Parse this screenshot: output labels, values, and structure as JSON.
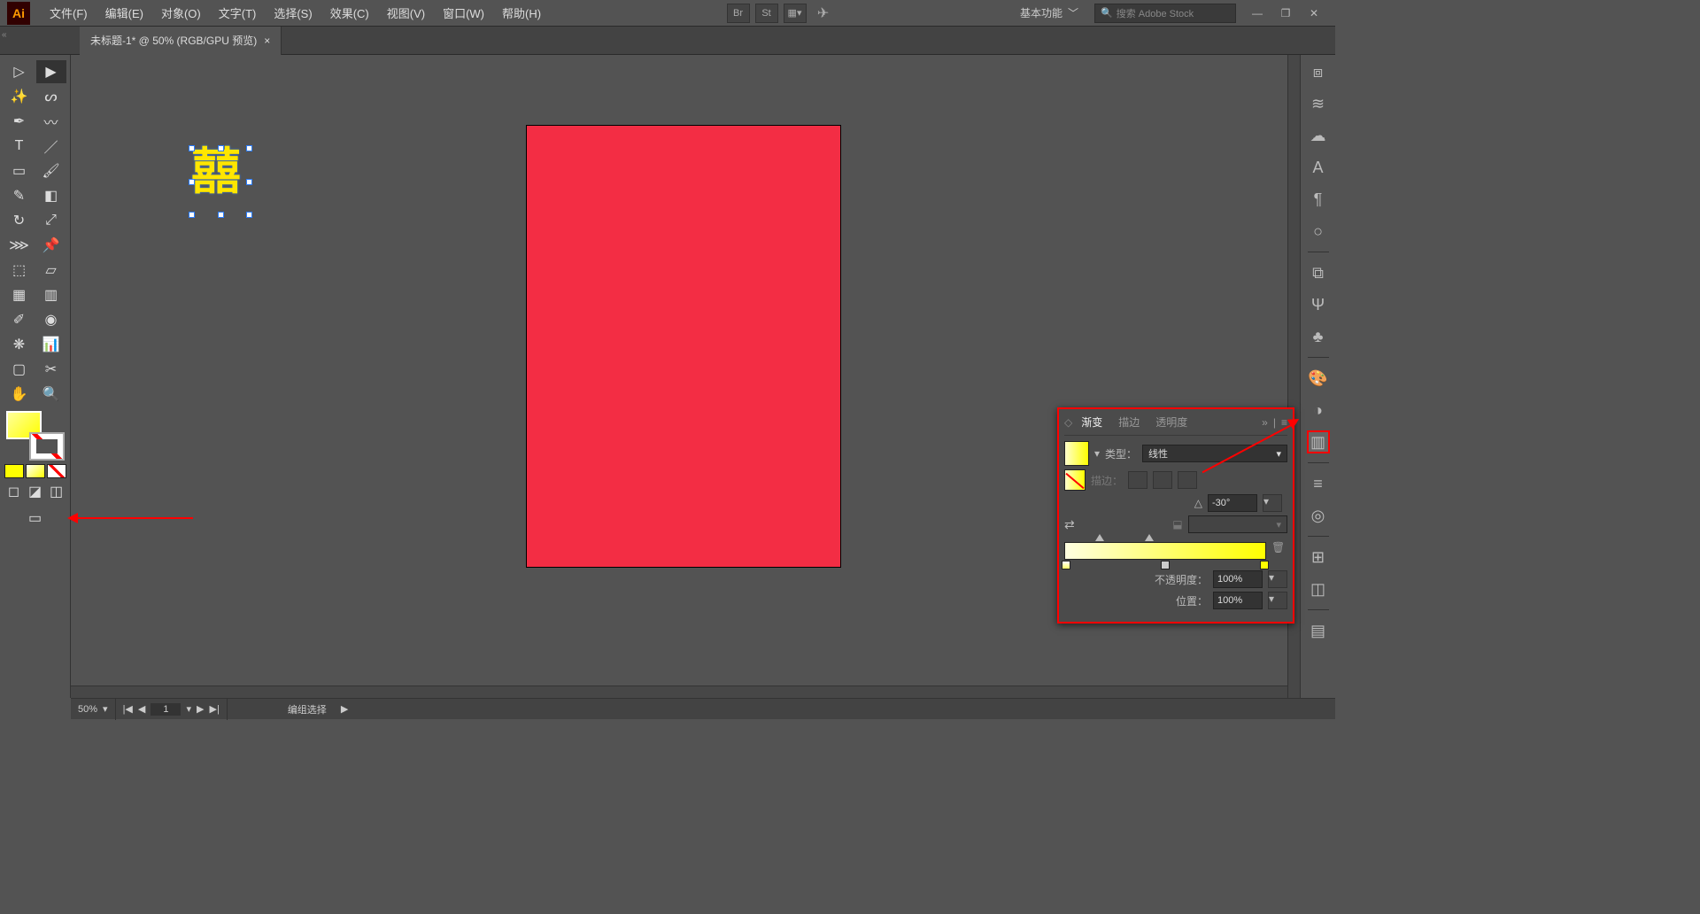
{
  "app": {
    "logo": "Ai"
  },
  "menu": {
    "file": "文件(F)",
    "edit": "编辑(E)",
    "object": "对象(O)",
    "type": "文字(T)",
    "select": "选择(S)",
    "effect": "效果(C)",
    "view": "视图(V)",
    "window": "窗口(W)",
    "help": "帮助(H)"
  },
  "menubar_right": {
    "br": "Br",
    "st": "St",
    "workspace": "基本功能",
    "search_placeholder": "搜索 Adobe Stock",
    "search_icon": "🔍"
  },
  "doc_tab": {
    "title": "未标题-1* @ 50% (RGB/GPU 预览)",
    "close": "×"
  },
  "right_dock_icons": [
    "cube",
    "layers",
    "cloud",
    "A",
    "para",
    "circle",
    "sep",
    "url",
    "trident",
    "club",
    "sep",
    "palette",
    "half",
    "gradient",
    "sep",
    "lines",
    "ring",
    "sep",
    "grid",
    "align",
    "sep",
    "admin"
  ],
  "gradient_panel": {
    "tab_gradient": "渐变",
    "tab_stroke": "描边",
    "tab_transparency": "透明度",
    "collapse": "»",
    "menu": "≡",
    "type_label": "类型：",
    "type_value": "线性",
    "stroke_label": "描边：",
    "angle": "-30°",
    "opacity_label": "不透明度：",
    "opacity_value": "100%",
    "position_label": "位置：",
    "position_value": "100%",
    "reverse_icon": "⇄"
  },
  "status": {
    "zoom": "50%",
    "page": "1",
    "tool": "编组选择",
    "nav_first": "|◀",
    "nav_prev": "◀",
    "nav_next": "▶",
    "nav_last": "▶|",
    "tri": "▶"
  }
}
